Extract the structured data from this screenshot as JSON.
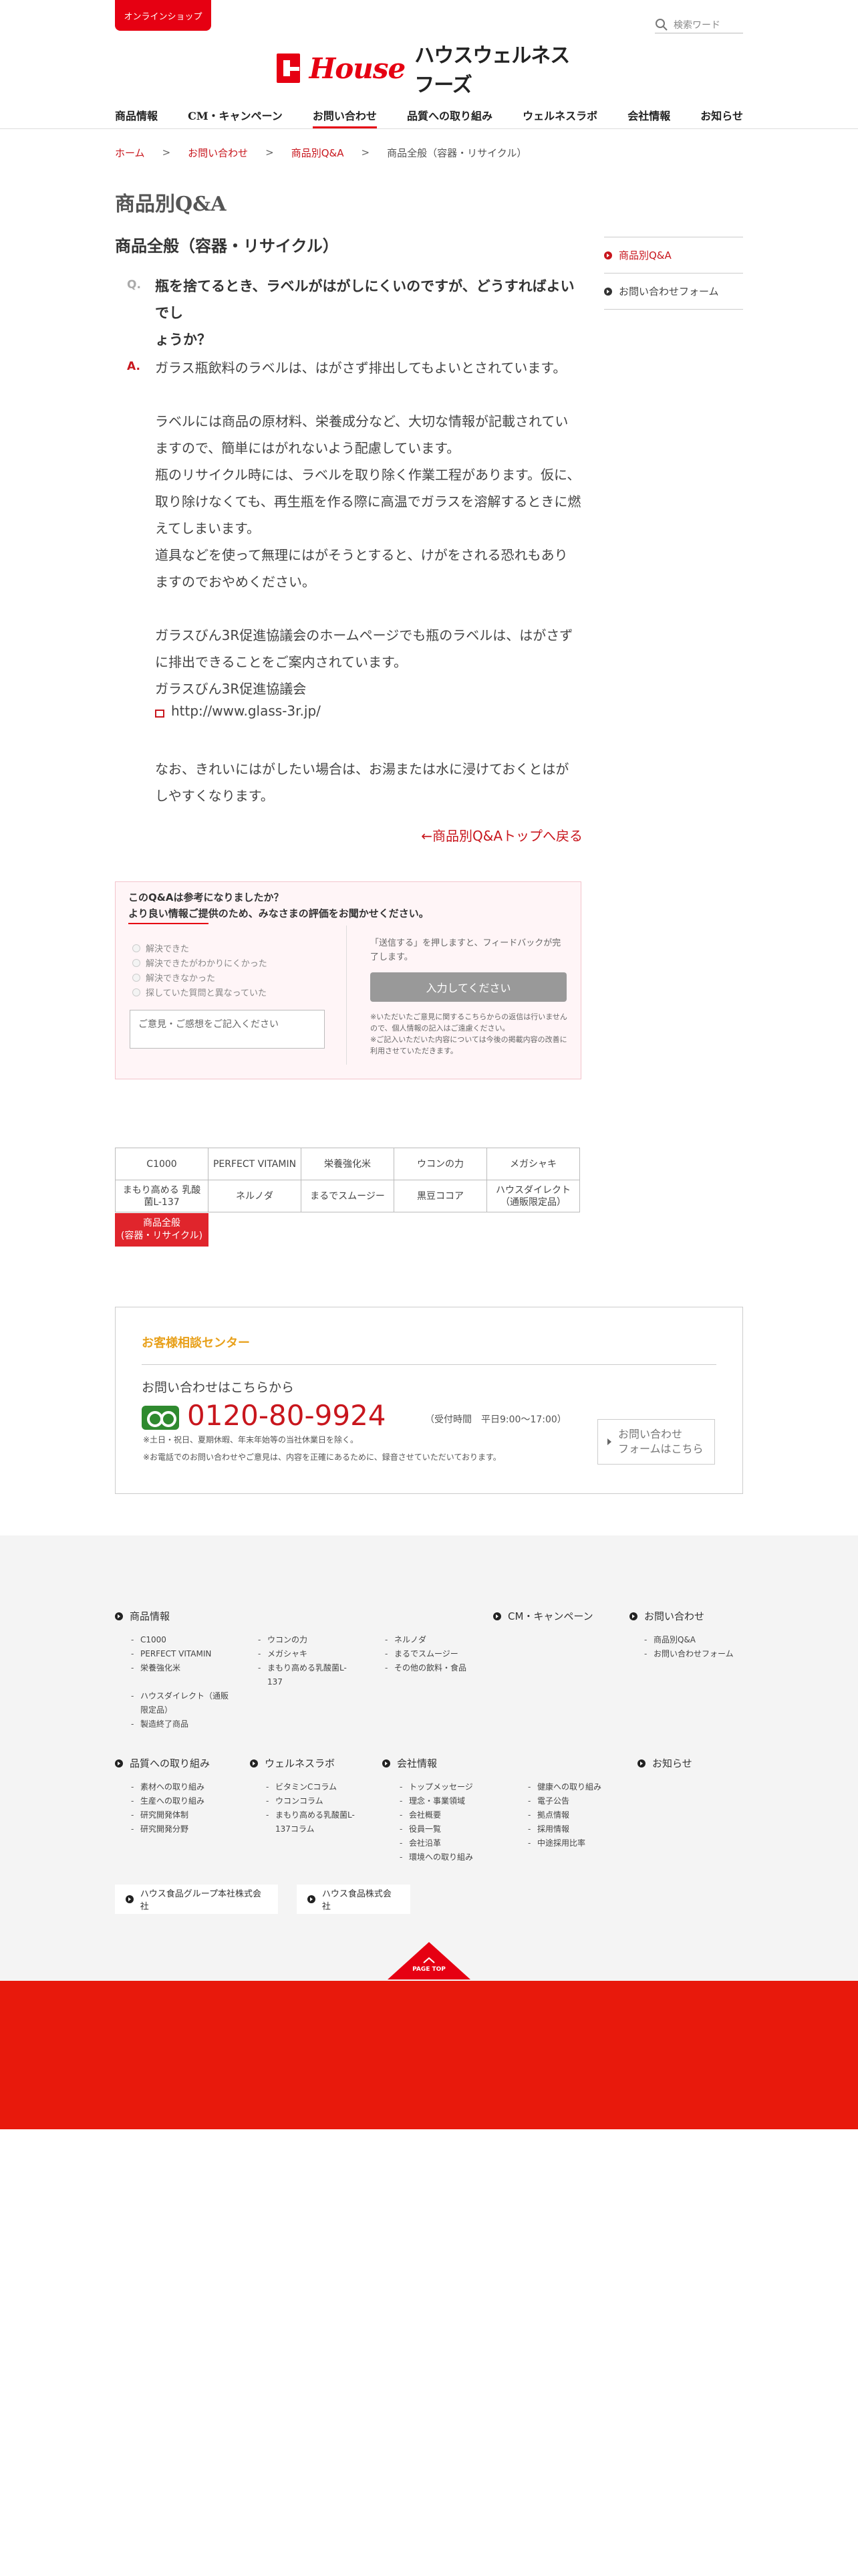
{
  "header": {
    "online_shop": "オンラインショップ",
    "search_placeholder": "検索ワード",
    "logo_house": "House",
    "logo_jp": "ハウスウェルネスフーズ"
  },
  "nav": {
    "items": [
      "商品情報",
      "CM・キャンペーン",
      "お問い合わせ",
      "品質への取り組み",
      "ウェルネスラボ",
      "会社情報",
      "お知らせ"
    ],
    "active_index": 2
  },
  "breadcrumb": {
    "home": "ホーム",
    "inquiry": "お問い合わせ",
    "qa": "商品別Q&A",
    "current": "商品全般（容器・リサイクル）",
    "sep": ">"
  },
  "page_title": "商品別Q&A",
  "section_title": "商品全般（容器・リサイクル）",
  "qa": {
    "q_label": "Q.",
    "question_lines": [
      "瓶を捨てるとき、ラベルがはがしにくいのですが、どうすればよいでし",
      "ょうか？"
    ],
    "a_label": "A.",
    "answer_lines": [
      "ガラス瓶飲料のラベルは、はがさず排出してもよいとされています。",
      "ラベルには商品の原材料、栄養成分など、大切な情報が記載されてい",
      "ますので、簡単にはがれないよう配慮しています。",
      "瓶のリサイクル時には、ラベルを取り除く作業工程があります。仮に、",
      "取り除けなくても、再生瓶を作る際に高温でガラスを溶解するときに燃",
      "えてしまいます。",
      "道具などを使って無理にはがそうとすると、けがをされる恐れもあり",
      "ますのでおやめください。",
      "ガラスびん3R促進協議会のホームページでも瓶のラベルは、はがさず",
      "に排出できることをご案内されています。",
      "ガラスびん3R促進協議会",
      "なお、きれいにはがしたい場合は、お湯または水に浸けておくとはが",
      "しやすくなります。"
    ],
    "external_url": "http://www.glass-3r.jp/",
    "back_link": "←商品別Q&Aトップへ戻る"
  },
  "sidebar": {
    "items": [
      "商品別Q&A",
      "お問い合わせフォーム"
    ],
    "active_index": 0
  },
  "survey": {
    "title_1": "このQ&Aは参考になりましたか？",
    "title_2": "より良い情報ご提供のため、みなさまの評価をお聞かせください。",
    "options": [
      "解決できた",
      "解決できたがわかりにくかった",
      "解決できなかった",
      "探していた質問と異なっていた"
    ],
    "comment_placeholder": "ご意見・ご感想をご記入ください",
    "note_1": "「送信する」を押しますと、フィードバックが完了します。",
    "submit": "入力してください",
    "note_2a": "※いただいたご意見に関するこちらからの返信は行いませんので、個人情報の記入はご遠慮ください。",
    "note_2b": "※ご記入いただいた内容については今後の掲載内容の改善に利用させていただきます。"
  },
  "product_grid": {
    "row1": [
      "C1000",
      "PERFECT VITAMIN",
      "栄養強化米",
      "ウコンの力",
      "メガシャキ"
    ],
    "row2": [
      "まもり高める 乳酸菌L-137",
      "ネルノダ",
      "まるでスムージー",
      "黒豆ココア",
      "ハウスダイレクト （通販限定品）"
    ],
    "active_line1": "商品全般",
    "active_line2": "(容器・リサイクル)"
  },
  "contact": {
    "title": "お客様相談センター",
    "sub": "お問い合わせはこちらから",
    "phone": "0120-80-9924",
    "hours": "（受付時間　平日9:00〜17:00）",
    "note_1": "※土日・祝日、夏期休暇、年末年始等の当社休業日を除く。",
    "note_2": "※お電話でのお問い合わせやご意見は、内容を正確にあるために、録音させていただいております。",
    "form_line1": "お問い合わせ",
    "form_line2": "フォームはこちら"
  },
  "footer": {
    "products": {
      "head": "商品情報",
      "col1": [
        "C1000",
        "PERFECT VITAMIN",
        "栄養強化米",
        "ハウスダイレクト（通販限定品）",
        "製造終了商品"
      ],
      "col2": [
        "ウコンの力",
        "メガシャキ",
        "まもり高める乳酸菌L-137"
      ],
      "col3": [
        "ネルノダ",
        "まるでスムージー",
        "その他の飲料・食品"
      ]
    },
    "cm": {
      "head": "CM・キャンペーン"
    },
    "inquiry": {
      "head": "お問い合わせ",
      "links": [
        "商品別Q&A",
        "お問い合わせフォーム"
      ]
    },
    "quality": {
      "head": "品質への取り組み",
      "links": [
        "素材への取り組み",
        "生産への取り組み",
        "研究開発体制",
        "研究開発分野"
      ]
    },
    "lab": {
      "head": "ウェルネスラボ",
      "links": [
        "ビタミンCコラム",
        "ウコンコラム",
        "まもり高める乳酸菌L-137コラム"
      ]
    },
    "company": {
      "head": "会社情報",
      "col1": [
        "トップメッセージ",
        "理念・事業領域",
        "会社概要",
        "役員一覧",
        "会社沿革",
        "環境への取り組み"
      ],
      "col2": [
        "健康への取り組み",
        "電子公告",
        "拠点情報",
        "採用情報",
        "中途採用比率"
      ]
    },
    "news": {
      "head": "お知らせ"
    },
    "group_1": "ハウス食品グループ本社株式会社",
    "group_2": "ハウス食品株式会社",
    "page_top": "PAGE TOP"
  }
}
